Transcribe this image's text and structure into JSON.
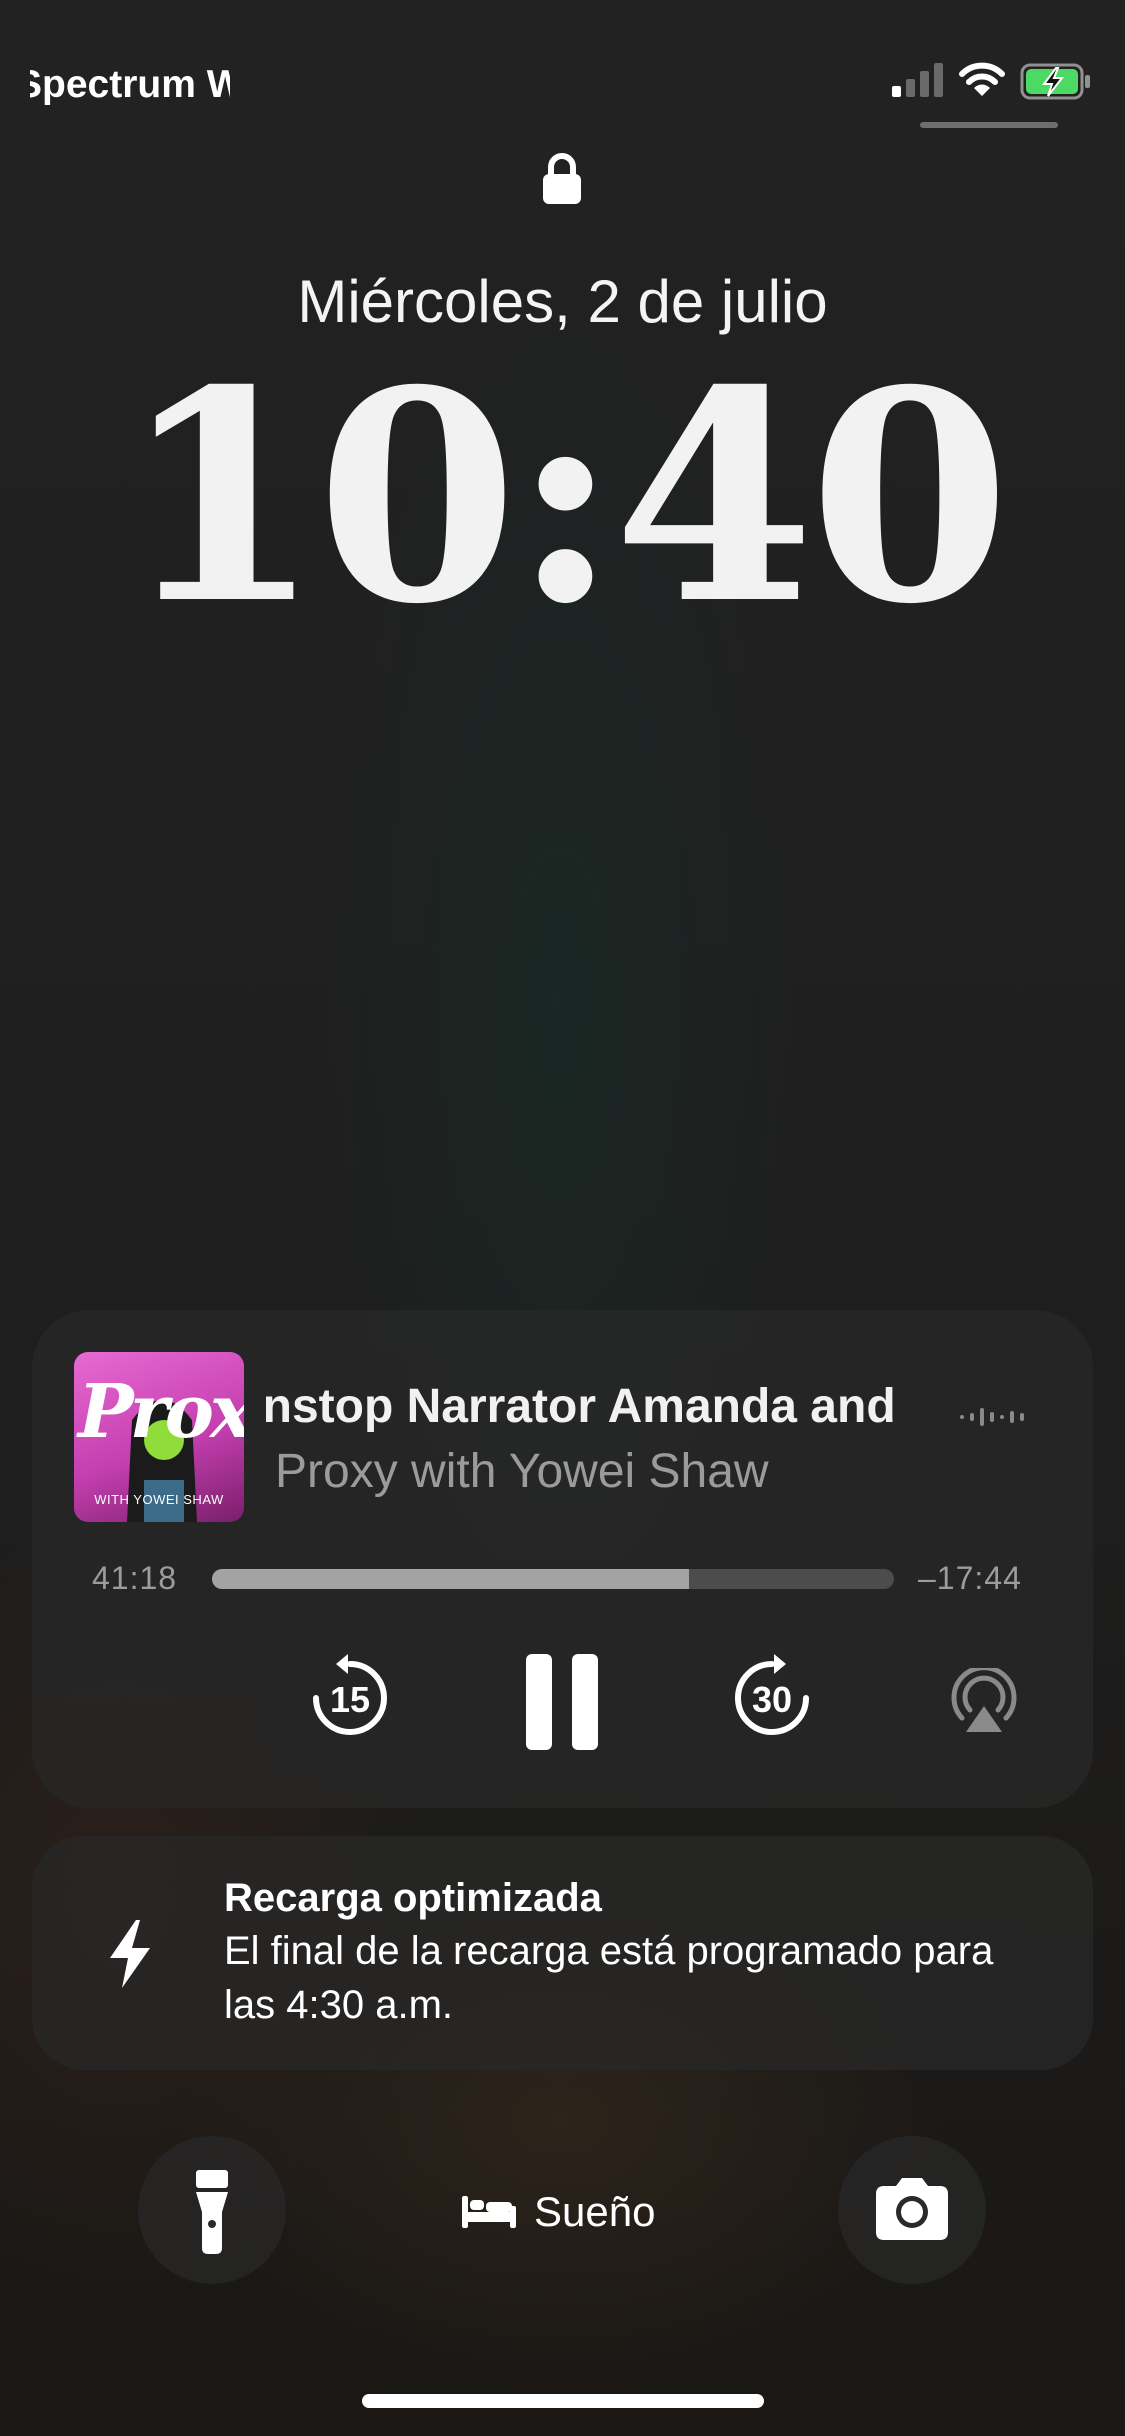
{
  "status_bar": {
    "carrier": "Spectrum Wi-Fi",
    "battery_color": "#4cd964"
  },
  "lock_screen": {
    "date": "Miércoles, 2 de julio",
    "time": "10:40"
  },
  "now_playing": {
    "artwork_title": "Proxy",
    "artwork_subtitle": "WITH YOWEI SHAW",
    "track_title": "Unstop Narrator       Amanda and",
    "podcast_name": "Proxy with Yowei Shaw",
    "elapsed": "41:18",
    "remaining": "–17:44",
    "progress_fraction": 0.7,
    "skip_back_seconds": "15",
    "skip_forward_seconds": "30"
  },
  "notification": {
    "title": "Recarga optimizada",
    "body": "El final de la recarga está programado para las 4:30 a.m."
  },
  "bottom": {
    "sleep_label": "Sueño"
  },
  "icons": {
    "lock": "lock-icon",
    "flashlight": "flashlight-icon",
    "camera": "camera-icon",
    "bed": "bed-icon",
    "bolt": "bolt-icon",
    "airplay": "airplay-audio-icon"
  }
}
